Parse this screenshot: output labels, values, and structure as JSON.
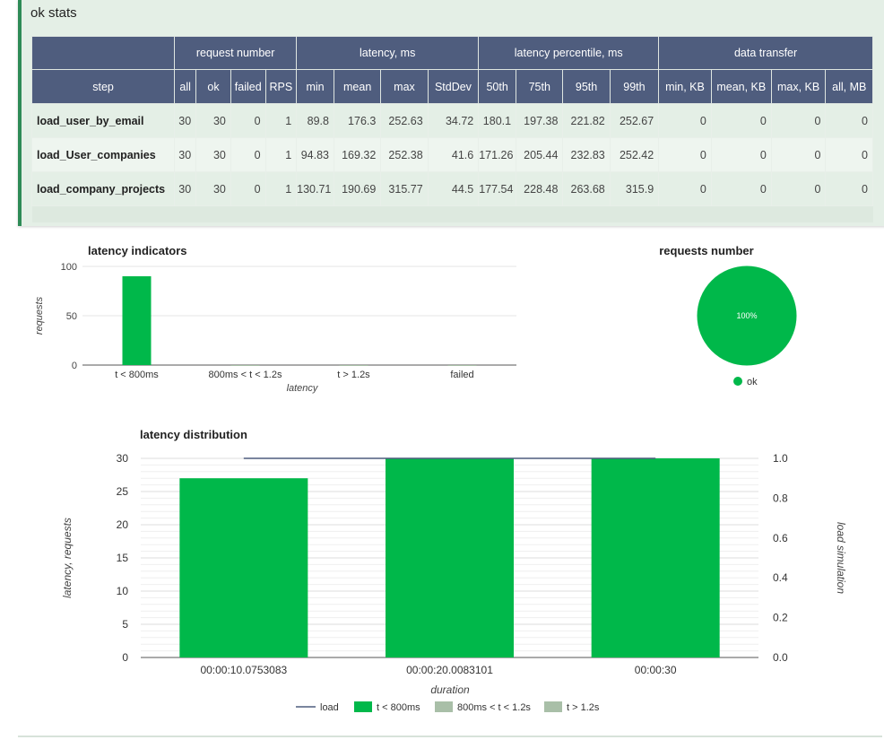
{
  "stats": {
    "title": "ok stats",
    "group_headers": [
      "request number",
      "latency, ms",
      "latency percentile, ms",
      "data transfer"
    ],
    "columns": [
      "step",
      "all",
      "ok",
      "failed",
      "RPS",
      "min",
      "mean",
      "max",
      "StdDev",
      "50th",
      "75th",
      "95th",
      "99th",
      "min, KB",
      "mean, KB",
      "max, KB",
      "all, MB"
    ],
    "rows": [
      [
        "load_user_by_email",
        "30",
        "30",
        "0",
        "1",
        "89.8",
        "176.3",
        "252.63",
        "34.72",
        "180.1",
        "197.38",
        "221.82",
        "252.67",
        "0",
        "0",
        "0",
        "0"
      ],
      [
        "load_User_companies",
        "30",
        "30",
        "0",
        "1",
        "94.83",
        "169.32",
        "252.38",
        "41.6",
        "171.26",
        "205.44",
        "232.83",
        "252.42",
        "0",
        "0",
        "0",
        "0"
      ],
      [
        "load_company_projects",
        "30",
        "30",
        "0",
        "1",
        "130.71",
        "190.69",
        "315.77",
        "44.5",
        "177.54",
        "228.48",
        "263.68",
        "315.9",
        "0",
        "0",
        "0",
        "0"
      ]
    ]
  },
  "colors": {
    "header_bg": "#4f5d7e",
    "card_bg": "#e4efe6",
    "card_accent": "#2e8b57",
    "ok_green": "#00b84a",
    "muted_series": "#a9bfa8",
    "load_line": "#4f5d7e"
  },
  "chart_data": [
    {
      "type": "bar",
      "title": "latency indicators",
      "xlabel": "latency",
      "ylabel": "requests",
      "categories": [
        "t < 800ms",
        "800ms < t < 1.2s",
        "t > 1.2s",
        "failed"
      ],
      "values": [
        90,
        0,
        0,
        0
      ],
      "ylim": [
        0,
        100
      ],
      "yticks": [
        "0",
        "50",
        "100"
      ]
    },
    {
      "type": "pie",
      "title": "requests number",
      "slices": [
        {
          "label": "ok",
          "value": 100,
          "display": "100%"
        }
      ],
      "legend": "bottom"
    },
    {
      "type": "bar",
      "title": "latency distribution",
      "xlabel": "duration",
      "ylabel": "latency, requests",
      "y2label": "load simulation",
      "categories": [
        "00:00:10.0753083",
        "00:00:20.0083101",
        "00:00:30"
      ],
      "ylim": [
        0,
        30
      ],
      "yticks": [
        "0",
        "5",
        "10",
        "15",
        "20",
        "25",
        "30"
      ],
      "y2lim": [
        0,
        1
      ],
      "y2ticks": [
        "0.0",
        "0.2",
        "0.4",
        "0.6",
        "0.8",
        "1.0"
      ],
      "series": [
        {
          "name": "load",
          "kind": "line",
          "axis": "right",
          "values": [
            1.0,
            1.0,
            1.0
          ]
        },
        {
          "name": "t < 800ms",
          "kind": "bar",
          "values": [
            27,
            30,
            30
          ]
        },
        {
          "name": "800ms < t < 1.2s",
          "kind": "bar",
          "values": [
            0,
            0,
            0
          ]
        },
        {
          "name": "t > 1.2s",
          "kind": "bar",
          "values": [
            0,
            0,
            0
          ]
        }
      ],
      "legend": "bottom",
      "grid": true
    }
  ]
}
